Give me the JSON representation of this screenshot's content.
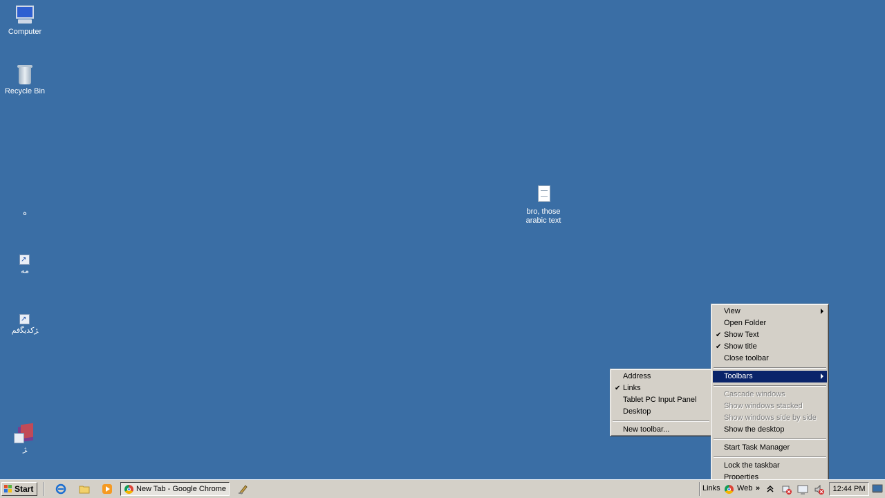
{
  "desktop": {
    "icons": [
      {
        "label": "Computer"
      },
      {
        "label": "Recycle Bin"
      },
      {
        "label": "bro, those arabic text"
      },
      {
        "label": "ﻩ"
      },
      {
        "label": "مه"
      },
      {
        "label": "ﮋﮐﺪﻳﮕﻓﻢ"
      },
      {
        "label": "ﮋ"
      }
    ]
  },
  "context_menu": {
    "items": [
      {
        "label": "View",
        "submenu": true
      },
      {
        "label": "Open Folder"
      },
      {
        "label": "Show Text",
        "checked": true
      },
      {
        "label": "Show title",
        "checked": true
      },
      {
        "label": "Close toolbar"
      },
      {
        "label": "Toolbars",
        "submenu": true,
        "highlighted": true
      },
      {
        "label": "Cascade windows",
        "disabled": true
      },
      {
        "label": "Show windows stacked",
        "disabled": true
      },
      {
        "label": "Show windows side by side",
        "disabled": true
      },
      {
        "label": "Show the desktop"
      },
      {
        "label": "Start Task Manager"
      },
      {
        "label": "Lock the taskbar"
      },
      {
        "label": "Properties"
      }
    ]
  },
  "toolbars_submenu": {
    "items": [
      {
        "label": "Address"
      },
      {
        "label": "Links",
        "checked": true
      },
      {
        "label": "Tablet PC Input Panel"
      },
      {
        "label": "Desktop"
      },
      {
        "label": "New toolbar..."
      }
    ]
  },
  "taskbar": {
    "start_label": "Start",
    "task_button_label": "New Tab - Google Chrome",
    "links_label": "Links",
    "web_label": "Web",
    "overflow_label": "»",
    "clock": "12:44 PM"
  },
  "check_glyph": "✔",
  "colors": {
    "desktop": "#3a6ea5",
    "menu_highlight": "#0a246a",
    "taskbar": "#d4d0c8"
  }
}
